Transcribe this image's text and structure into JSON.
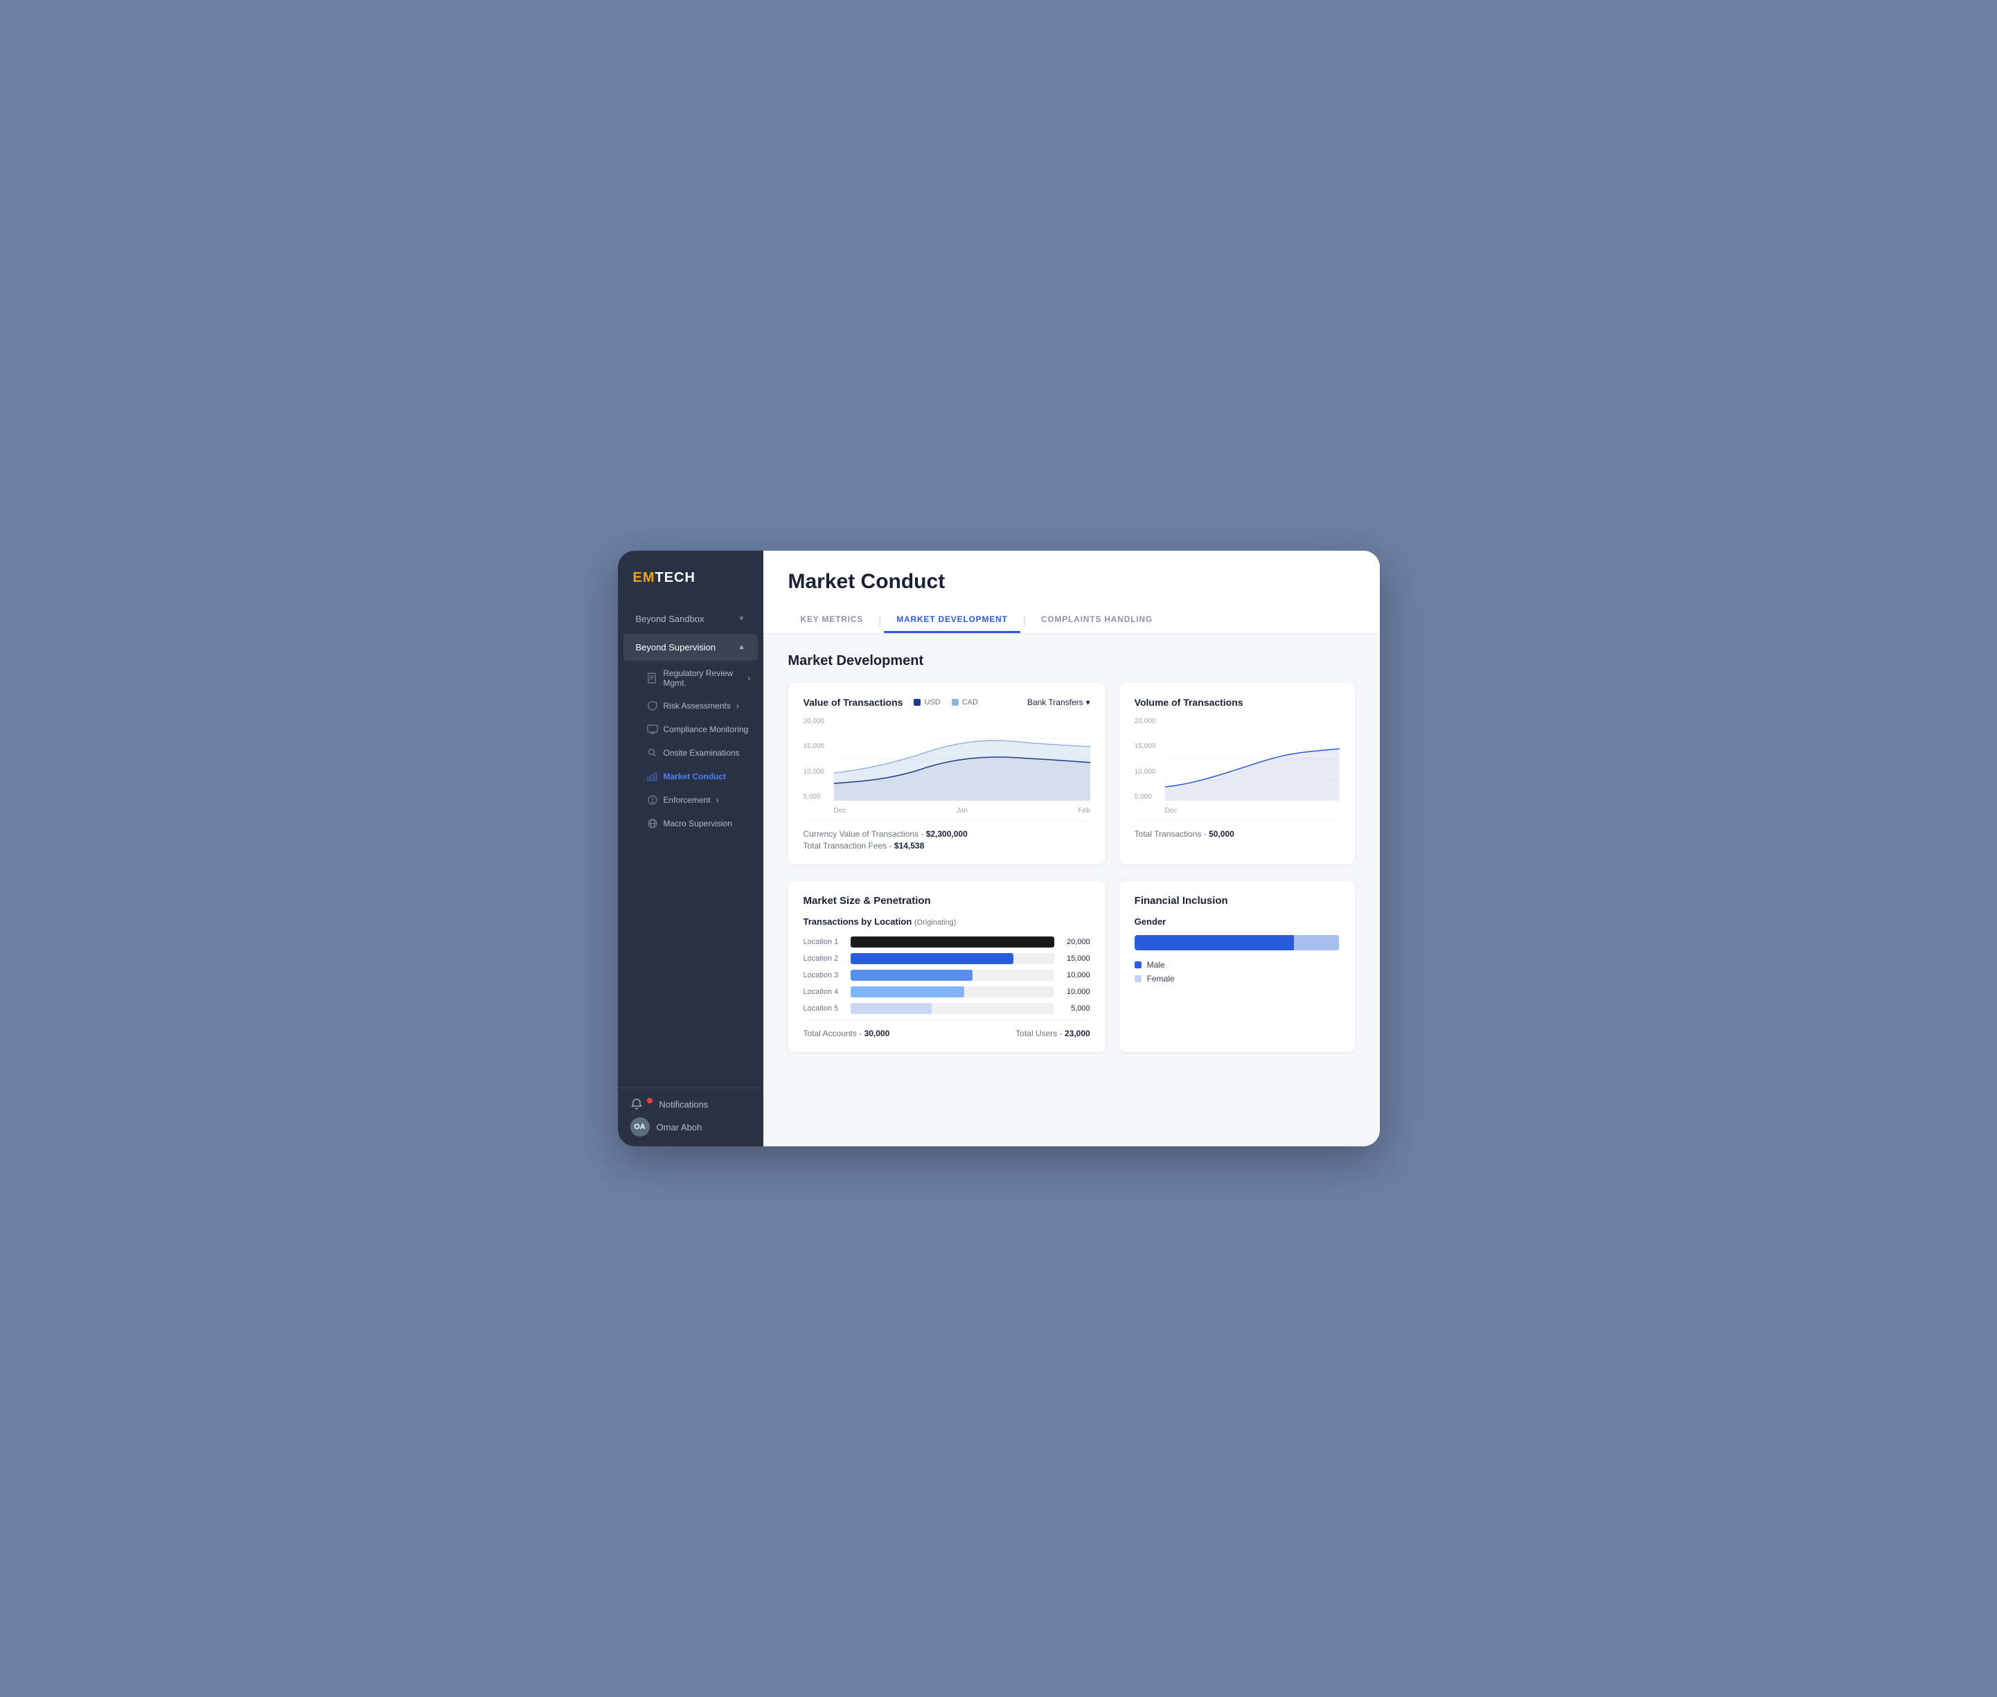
{
  "sidebar": {
    "logo_em": "EM",
    "logo_tech": "TECH",
    "nav_items": [
      {
        "id": "beyond-sandbox",
        "label": "Beyond Sandbox",
        "hasChevron": true,
        "chevron": "▼",
        "active": false
      },
      {
        "id": "beyond-supervision",
        "label": "Beyond Supervision",
        "hasChevron": true,
        "chevron": "▲",
        "active": true
      }
    ],
    "sub_items": [
      {
        "id": "regulatory-review",
        "label": "Regulatory Review Mgmt."
      },
      {
        "id": "risk-assessments",
        "label": "Risk Assessments"
      },
      {
        "id": "compliance-monitoring",
        "label": "Compliance Monitoring"
      },
      {
        "id": "onsite-examinations",
        "label": "Onsite Examinations"
      },
      {
        "id": "market-conduct",
        "label": "Market Conduct",
        "active": true
      },
      {
        "id": "enforcement",
        "label": "Enforcement"
      },
      {
        "id": "macro-supervision",
        "label": "Macro Supervision"
      }
    ],
    "footer": {
      "notifications_label": "Notifications",
      "user_name": "Omar Aboh",
      "user_initials": "OA"
    }
  },
  "page": {
    "title": "Market Conduct",
    "tabs": [
      {
        "id": "key-metrics",
        "label": "KEY METRICS",
        "active": false
      },
      {
        "id": "market-development",
        "label": "MARKET DEVELOPMENT",
        "active": true
      },
      {
        "id": "complaints-handling",
        "label": "COMPLAINTS HANDLING",
        "active": false
      }
    ],
    "section_title": "Market Development"
  },
  "value_of_transactions": {
    "title": "Value of Transactions",
    "dropdown_label": "Bank Transfers",
    "legend": [
      {
        "id": "usd",
        "label": "USD",
        "color": "#1e3a8a"
      },
      {
        "id": "cad",
        "label": "CAD",
        "color": "#93b4d8"
      }
    ],
    "y_labels": [
      "20,000",
      "15,000",
      "10,000",
      "5,000"
    ],
    "x_labels": [
      "Dec",
      "Jan",
      "Feb"
    ],
    "currency_value_label": "Currency Value of Transactions -",
    "currency_value": "$2,300,000",
    "transaction_fees_label": "Total Transaction Fees -",
    "transaction_fees": "$14,538"
  },
  "volume_of_transactions": {
    "title": "Volume of Transactions",
    "y_labels": [
      "20,000",
      "15,000",
      "10,000",
      "5,000"
    ],
    "x_labels": [
      "Dec"
    ],
    "total_label": "Total Transactions -",
    "total_value": "50,000"
  },
  "market_size": {
    "title": "Market Size & Penetration",
    "chart_title": "Transactions by Location",
    "chart_subtitle": "(Originating)",
    "bars": [
      {
        "label": "Location 1",
        "value": "20,000",
        "width": 100,
        "color": "#1a1a1a"
      },
      {
        "label": "Location 2",
        "value": "15,000",
        "width": 80,
        "color": "#2b5cdb"
      },
      {
        "label": "Location 3",
        "value": "10,000",
        "width": 60,
        "color": "#5a8dee"
      },
      {
        "label": "Location 4",
        "value": "10,000",
        "width": 56,
        "color": "#7fb3f5"
      },
      {
        "label": "Location 5",
        "value": "5,000",
        "width": 40,
        "color": "#c8d8f0"
      }
    ],
    "footer_accounts_label": "Total Accounts -",
    "footer_accounts_value": "30,000",
    "footer_users_label": "Total Users -",
    "footer_users_value": "23,000"
  },
  "financial_inclusion": {
    "title": "Financial Inclusion",
    "gender_section_title": "Gender",
    "male_pct": 78,
    "female_pct": 22,
    "male_color": "#2b5cdb",
    "female_color": "#c3d3ef",
    "legend": [
      {
        "label": "Male",
        "color": "#2b5cdb"
      },
      {
        "label": "Female",
        "color": "#c3d3ef"
      }
    ]
  }
}
